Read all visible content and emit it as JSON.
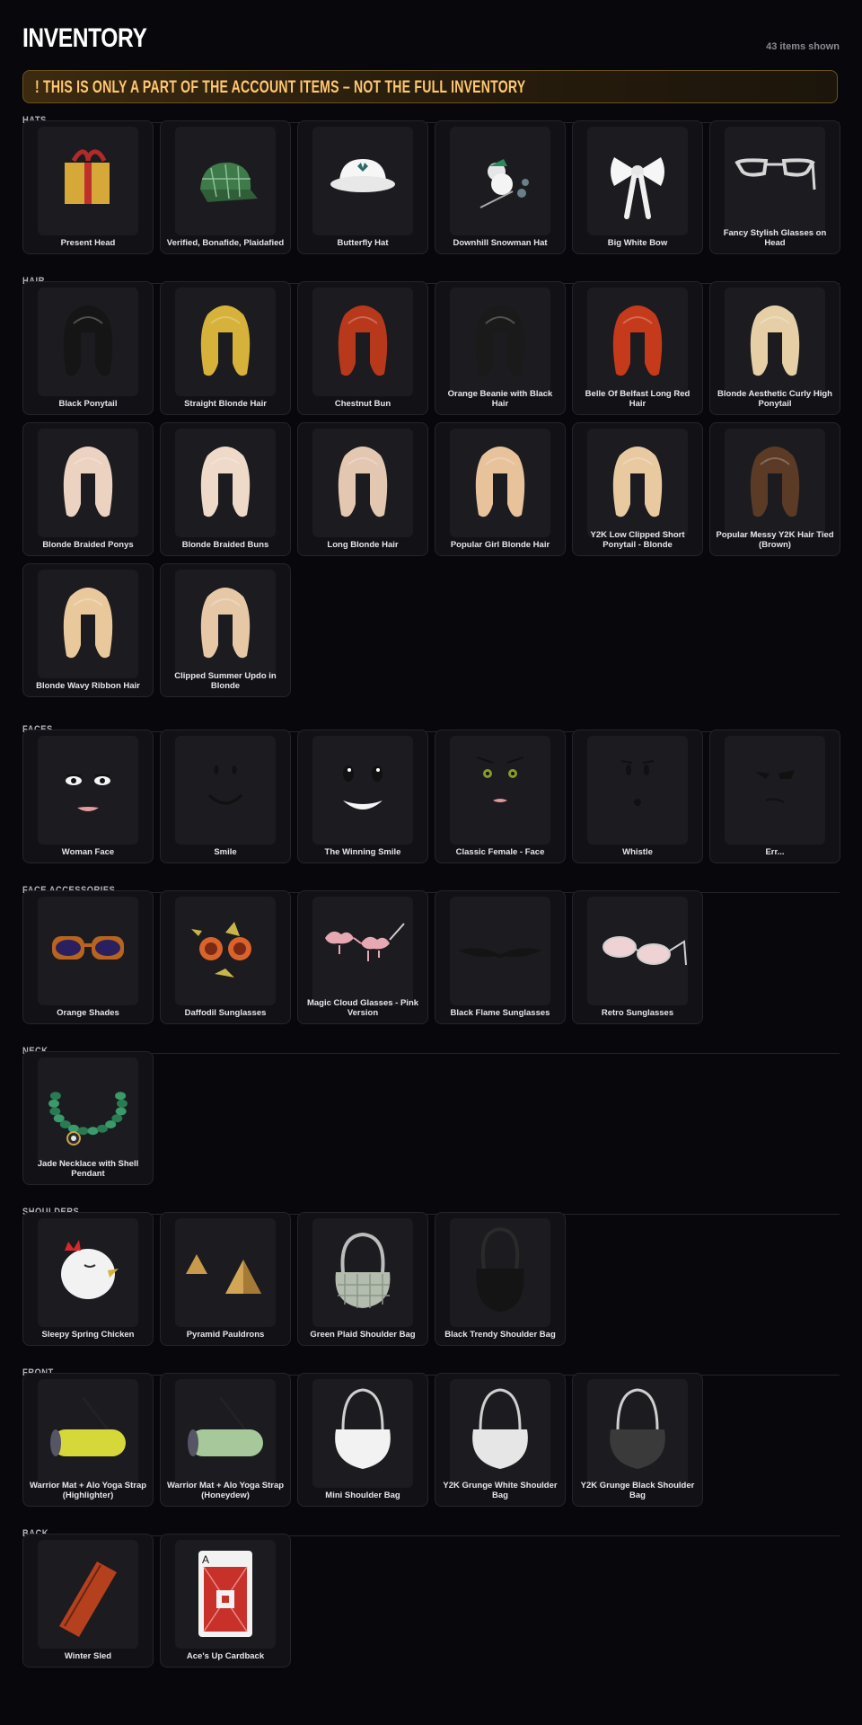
{
  "page": {
    "title": "INVENTORY",
    "count": "43 items shown"
  },
  "banner": {
    "text": "! THIS IS ONLY A PART OF THE ACCOUNT ITEMS – NOT THE FULL INVENTORY"
  },
  "sections": {
    "hats": {
      "title": "HATS",
      "items": [
        {
          "name": "Present Head",
          "icon": "gift-box-icon"
        },
        {
          "name": "Verified, Bonafide, Plaidafied",
          "icon": "plaid-cap-icon"
        },
        {
          "name": "Butterfly Hat",
          "icon": "bucket-hat-icon"
        },
        {
          "name": "Downhill Snowman Hat",
          "icon": "snowman-hat-icon"
        },
        {
          "name": "Big White Bow",
          "icon": "white-bow-icon"
        },
        {
          "name": "Fancy Stylish Glasses on Head",
          "icon": "glasses-icon"
        }
      ]
    },
    "hair": {
      "title": "HAIR",
      "items": [
        {
          "name": "Black Ponytail",
          "icon": "hair-icon"
        },
        {
          "name": "Straight Blonde Hair",
          "icon": "hair-icon"
        },
        {
          "name": "Chestnut Bun",
          "icon": "hair-icon"
        },
        {
          "name": "Orange Beanie with Black Hair",
          "icon": "hair-icon"
        },
        {
          "name": "Belle Of Belfast Long Red Hair",
          "icon": "hair-icon"
        },
        {
          "name": "Blonde Aesthetic Curly High Ponytail",
          "icon": "hair-icon"
        },
        {
          "name": "Blonde Braided Ponys",
          "icon": "hair-icon"
        },
        {
          "name": "Blonde Braided Buns",
          "icon": "hair-icon"
        },
        {
          "name": "Long Blonde Hair",
          "icon": "hair-icon"
        },
        {
          "name": "Popular Girl Blonde Hair",
          "icon": "hair-icon"
        },
        {
          "name": "Y2K Low Clipped Short Ponytail - Blonde",
          "icon": "hair-icon"
        },
        {
          "name": "Popular Messy Y2K Hair Tied (Brown)",
          "icon": "hair-icon"
        },
        {
          "name": "Blonde Wavy Ribbon Hair",
          "icon": "hair-icon"
        },
        {
          "name": "Clipped Summer Updo in Blonde",
          "icon": "hair-icon"
        }
      ]
    },
    "faces": {
      "title": "FACES",
      "items": [
        {
          "name": "Woman Face",
          "icon": "face-icon"
        },
        {
          "name": "Smile",
          "icon": "face-icon"
        },
        {
          "name": "The Winning Smile",
          "icon": "face-icon"
        },
        {
          "name": "Classic Female - Face",
          "icon": "face-icon"
        },
        {
          "name": "Whistle",
          "icon": "face-icon"
        },
        {
          "name": "Err...",
          "icon": "face-icon"
        }
      ]
    },
    "face_accessories": {
      "title": "FACE ACCESSORIES",
      "items": [
        {
          "name": "Orange Shades",
          "icon": "sunglasses-icon"
        },
        {
          "name": "Daffodil Sunglasses",
          "icon": "sunglasses-icon"
        },
        {
          "name": "Magic Cloud Glasses - Pink Version",
          "icon": "sunglasses-icon"
        },
        {
          "name": "Black Flame Sunglasses",
          "icon": "sunglasses-icon"
        },
        {
          "name": "Retro Sunglasses",
          "icon": "sunglasses-icon"
        }
      ]
    },
    "neck": {
      "title": "NECK",
      "items": [
        {
          "name": "Jade Necklace with Shell Pendant",
          "icon": "necklace-icon"
        }
      ]
    },
    "shoulders": {
      "title": "SHOULDERS",
      "items": [
        {
          "name": "Sleepy Spring Chicken",
          "icon": "chicken-icon"
        },
        {
          "name": "Pyramid Pauldrons",
          "icon": "pyramid-icon"
        },
        {
          "name": "Green Plaid Shoulder Bag",
          "icon": "bag-icon"
        },
        {
          "name": "Black Trendy Shoulder Bag",
          "icon": "bag-icon"
        }
      ]
    },
    "front": {
      "title": "FRONT",
      "items": [
        {
          "name": "Warrior Mat + Alo Yoga Strap (Highlighter)",
          "icon": "yoga-mat-icon"
        },
        {
          "name": "Warrior Mat + Alo Yoga Strap (Honeydew)",
          "icon": "yoga-mat-icon"
        },
        {
          "name": "Mini Shoulder Bag",
          "icon": "bag-icon"
        },
        {
          "name": "Y2K Grunge White Shoulder Bag",
          "icon": "bag-icon"
        },
        {
          "name": "Y2K Grunge Black Shoulder Bag",
          "icon": "bag-icon"
        }
      ]
    },
    "back": {
      "title": "BACK",
      "items": [
        {
          "name": "Winter Sled",
          "icon": "sled-icon"
        },
        {
          "name": "Ace's Up Cardback",
          "icon": "playing-card-icon"
        }
      ]
    }
  }
}
